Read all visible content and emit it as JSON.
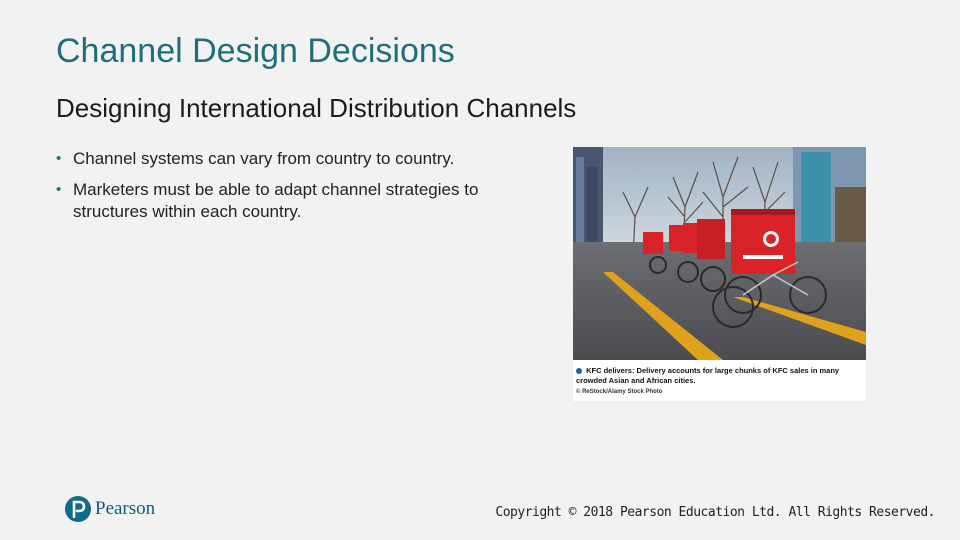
{
  "slide": {
    "title": "Channel Design Decisions",
    "subtitle": "Designing International Distribution Channels",
    "bullets": [
      "Channel systems can vary from country to country.",
      "Marketers must be able to adapt channel strategies to structures within each country."
    ]
  },
  "figure": {
    "caption": "KFC delivers: Delivery accounts for large chunks of KFC sales in many crowded Asian and African cities.",
    "credit": "© ReStock/Alamy Stock Photo"
  },
  "footer": {
    "brand": "Pearson",
    "copyright": "Copyright © 2018 Pearson Education Ltd. All Rights Reserved."
  },
  "colors": {
    "title": "#1f6e7a",
    "brand": "#0e6b8a",
    "kfc_red": "#d92328"
  }
}
